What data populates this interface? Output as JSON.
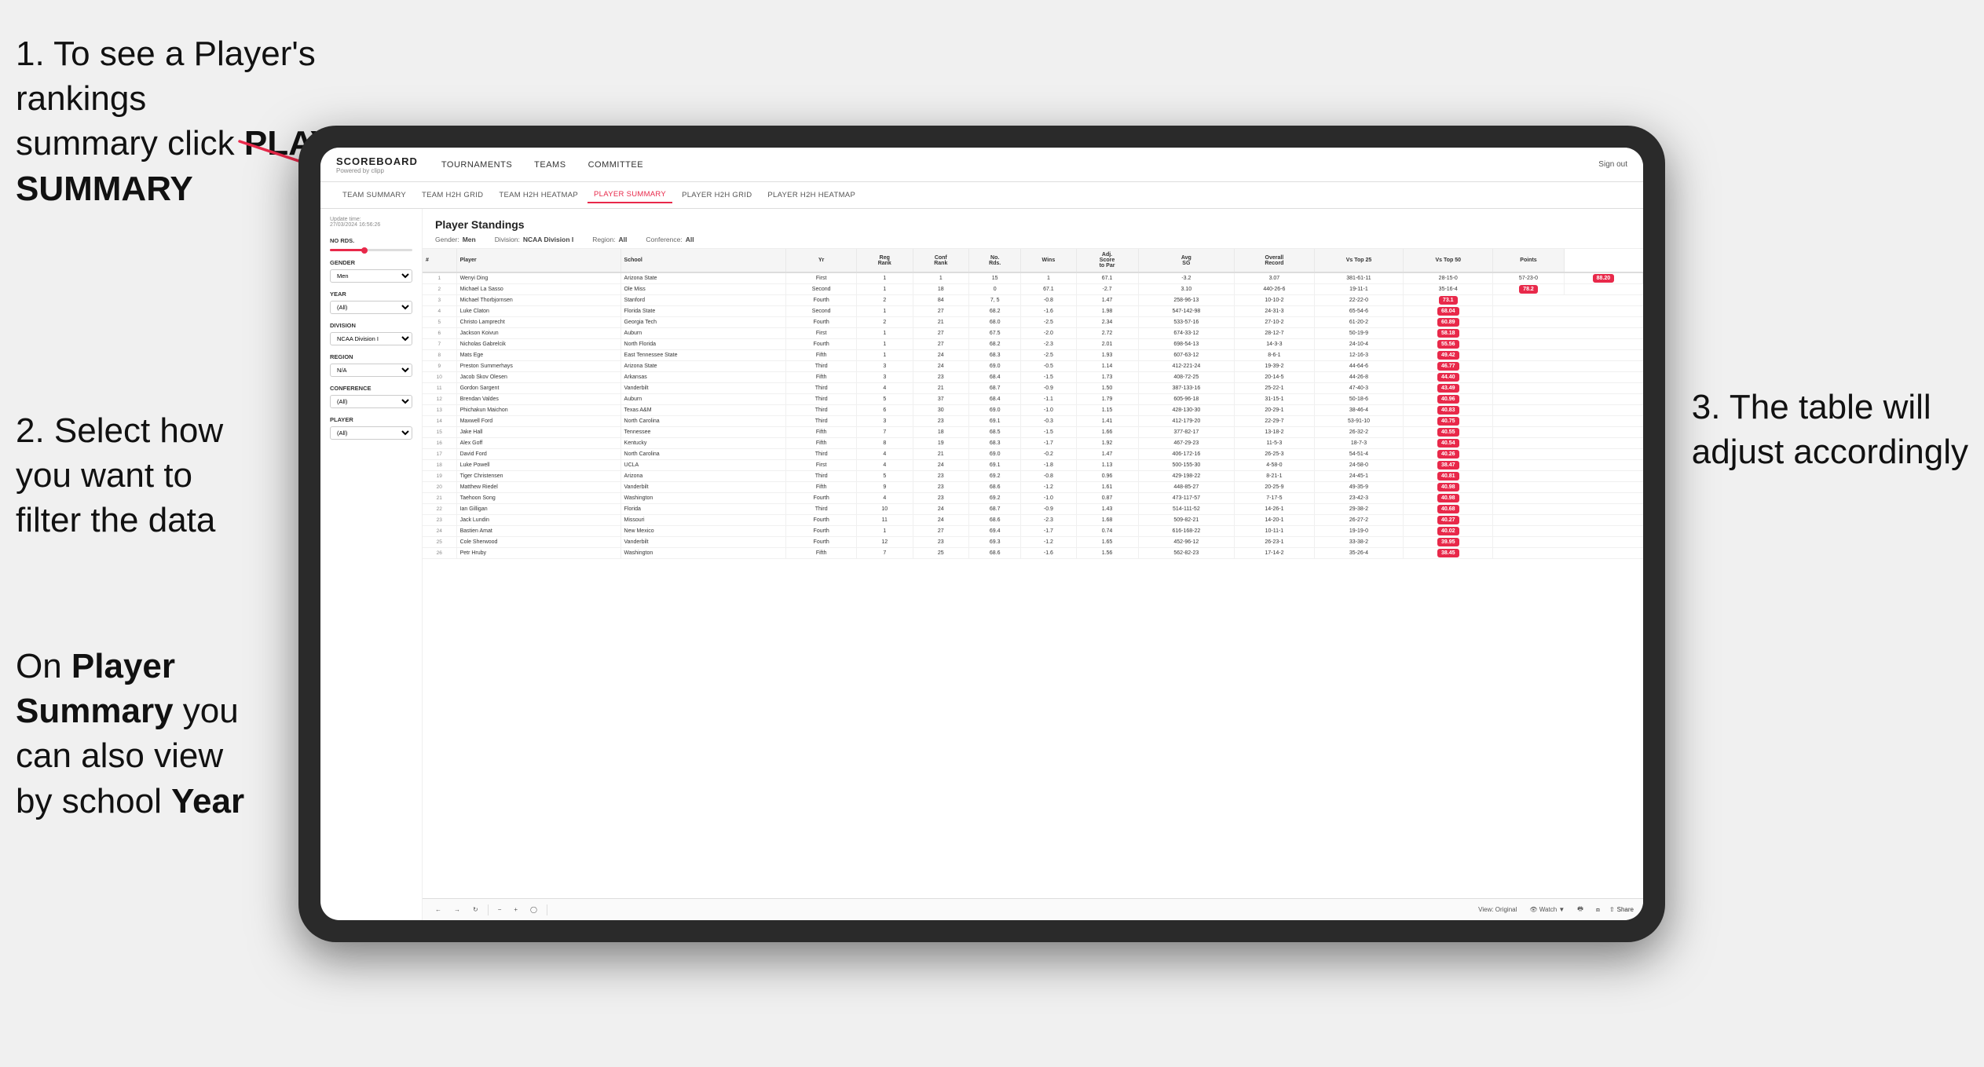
{
  "annotations": {
    "note1_line1": "1. To see a Player's rankings",
    "note1_line2": "summary click ",
    "note1_bold": "PLAYER SUMMARY",
    "note2_line1": "2. Select how",
    "note2_line2": "you want to",
    "note2_line3": "filter the data",
    "note2b_line1": "On ",
    "note2b_bold1": "Player",
    "note2b_line2": "Summary",
    "note2b_line3": " you",
    "note2b_line4": "can also view",
    "note2b_line5": "by school ",
    "note2b_bold2": "Year",
    "note3_line1": "3. The table will",
    "note3_line2": "adjust accordingly"
  },
  "nav": {
    "logo": "SCOREBOARD",
    "logo_sub": "Powered by clipp",
    "links": [
      "TOURNAMENTS",
      "TEAMS",
      "COMMITTEE"
    ],
    "sign_out": "Sign out"
  },
  "sub_nav": {
    "links": [
      "TEAM SUMMARY",
      "TEAM H2H GRID",
      "TEAM H2H HEATMAP",
      "PLAYER SUMMARY",
      "PLAYER H2H GRID",
      "PLAYER H2H HEATMAP"
    ],
    "active": "PLAYER SUMMARY"
  },
  "filters": {
    "update_time_label": "Update time:",
    "update_time_value": "27/03/2024 16:56:26",
    "no_rds_label": "No Rds.",
    "gender_label": "Gender",
    "gender_value": "Men",
    "year_label": "Year",
    "year_value": "(All)",
    "division_label": "Division",
    "division_value": "NCAA Division I",
    "region_label": "Region",
    "region_value": "N/A",
    "conference_label": "Conference",
    "conference_value": "(All)",
    "player_label": "Player",
    "player_value": "(All)"
  },
  "standings": {
    "title": "Player Standings",
    "gender_label": "Gender:",
    "gender_value": "Men",
    "division_label": "Division:",
    "division_value": "NCAA Division I",
    "region_label": "Region:",
    "region_value": "All",
    "conference_label": "Conference:",
    "conference_value": "All"
  },
  "table": {
    "headers": [
      "#",
      "Player",
      "School",
      "Yr",
      "Reg Rank",
      "Conf Rank",
      "No. Rds.",
      "Wins",
      "Adj. Score to Par",
      "Avg SG",
      "Overall Record",
      "Vs Top 25",
      "Vs Top 50",
      "Points"
    ],
    "rows": [
      [
        "1",
        "Wenyi Ding",
        "Arizona State",
        "First",
        "1",
        "1",
        "15",
        "1",
        "67.1",
        "-3.2",
        "3.07",
        "381-61-11",
        "28-15-0",
        "57-23-0",
        "88.20"
      ],
      [
        "2",
        "Michael La Sasso",
        "Ole Miss",
        "Second",
        "1",
        "18",
        "0",
        "67.1",
        "-2.7",
        "3.10",
        "440-26-6",
        "19-11-1",
        "35-16-4",
        "78.2"
      ],
      [
        "3",
        "Michael Thorbjornsen",
        "Stanford",
        "Fourth",
        "2",
        "84",
        "7, 5",
        "-0.8",
        "1.47",
        "258-96-13",
        "10-10-2",
        "22-22-0",
        "73.1"
      ],
      [
        "4",
        "Luke Claton",
        "Florida State",
        "Second",
        "1",
        "27",
        "68.2",
        "-1.6",
        "1.98",
        "547-142-98",
        "24-31-3",
        "65-54-6",
        "68.04"
      ],
      [
        "5",
        "Christo Lamprecht",
        "Georgia Tech",
        "Fourth",
        "2",
        "21",
        "68.0",
        "-2.5",
        "2.34",
        "533-57-16",
        "27-10-2",
        "61-20-2",
        "60.89"
      ],
      [
        "6",
        "Jackson Koivun",
        "Auburn",
        "First",
        "1",
        "27",
        "67.5",
        "-2.0",
        "2.72",
        "674-33-12",
        "28-12-7",
        "50-19-9",
        "58.18"
      ],
      [
        "7",
        "Nicholas Gabrelcik",
        "North Florida",
        "Fourth",
        "1",
        "27",
        "68.2",
        "-2.3",
        "2.01",
        "698-54-13",
        "14-3-3",
        "24-10-4",
        "55.56"
      ],
      [
        "8",
        "Mats Ege",
        "East Tennessee State",
        "Fifth",
        "1",
        "24",
        "68.3",
        "-2.5",
        "1.93",
        "607-63-12",
        "8-6-1",
        "12-16-3",
        "49.42"
      ],
      [
        "9",
        "Preston Summerhays",
        "Arizona State",
        "Third",
        "3",
        "24",
        "69.0",
        "-0.5",
        "1.14",
        "412-221-24",
        "19-39-2",
        "44-64-6",
        "46.77"
      ],
      [
        "10",
        "Jacob Skov Olesen",
        "Arkansas",
        "Fifth",
        "3",
        "23",
        "68.4",
        "-1.5",
        "1.73",
        "408-72-25",
        "20-14-5",
        "44-26-8",
        "44.40"
      ],
      [
        "11",
        "Gordon Sargent",
        "Vanderbilt",
        "Third",
        "4",
        "21",
        "68.7",
        "-0.9",
        "1.50",
        "387-133-16",
        "25-22-1",
        "47-40-3",
        "43.49"
      ],
      [
        "12",
        "Brendan Valdes",
        "Auburn",
        "Third",
        "5",
        "37",
        "68.4",
        "-1.1",
        "1.79",
        "605-96-18",
        "31-15-1",
        "50-18-6",
        "40.96"
      ],
      [
        "13",
        "Phichakun Maichon",
        "Texas A&M",
        "Third",
        "6",
        "30",
        "69.0",
        "-1.0",
        "1.15",
        "428-130-30",
        "20-29-1",
        "38-46-4",
        "40.83"
      ],
      [
        "14",
        "Maxwell Ford",
        "North Carolina",
        "Third",
        "3",
        "23",
        "69.1",
        "-0.3",
        "1.41",
        "412-179-20",
        "22-29-7",
        "53-91-10",
        "40.75"
      ],
      [
        "15",
        "Jake Hall",
        "Tennessee",
        "Fifth",
        "7",
        "18",
        "68.5",
        "-1.5",
        "1.66",
        "377-82-17",
        "13-18-2",
        "26-32-2",
        "40.55"
      ],
      [
        "16",
        "Alex Goff",
        "Kentucky",
        "Fifth",
        "8",
        "19",
        "68.3",
        "-1.7",
        "1.92",
        "467-29-23",
        "11-5-3",
        "18-7-3",
        "40.54"
      ],
      [
        "17",
        "David Ford",
        "North Carolina",
        "Third",
        "4",
        "21",
        "69.0",
        "-0.2",
        "1.47",
        "406-172-16",
        "26-25-3",
        "54-51-4",
        "40.26"
      ],
      [
        "18",
        "Luke Powell",
        "UCLA",
        "First",
        "4",
        "24",
        "69.1",
        "-1.8",
        "1.13",
        "500-155-30",
        "4-58-0",
        "24-58-0",
        "38.47"
      ],
      [
        "19",
        "Tiger Christensen",
        "Arizona",
        "Third",
        "5",
        "23",
        "69.2",
        "-0.8",
        "0.96",
        "429-198-22",
        "8-21-1",
        "24-45-1",
        "40.81"
      ],
      [
        "20",
        "Matthew Riedel",
        "Vanderbilt",
        "Fifth",
        "9",
        "23",
        "68.6",
        "-1.2",
        "1.61",
        "448-85-27",
        "20-25-9",
        "49-35-9",
        "40.98"
      ],
      [
        "21",
        "Taehoon Song",
        "Washington",
        "Fourth",
        "4",
        "23",
        "69.2",
        "-1.0",
        "0.87",
        "473-117-57",
        "7-17-5",
        "23-42-3",
        "40.98"
      ],
      [
        "22",
        "Ian Gilligan",
        "Florida",
        "Third",
        "10",
        "24",
        "68.7",
        "-0.9",
        "1.43",
        "514-111-52",
        "14-26-1",
        "29-38-2",
        "40.68"
      ],
      [
        "23",
        "Jack Lundin",
        "Missouri",
        "Fourth",
        "11",
        "24",
        "68.6",
        "-2.3",
        "1.68",
        "509-82-21",
        "14-20-1",
        "26-27-2",
        "40.27"
      ],
      [
        "24",
        "Bastien Amat",
        "New Mexico",
        "Fourth",
        "1",
        "27",
        "69.4",
        "-1.7",
        "0.74",
        "616-168-22",
        "10-11-1",
        "19-19-0",
        "40.02"
      ],
      [
        "25",
        "Cole Sherwood",
        "Vanderbilt",
        "Fourth",
        "12",
        "23",
        "69.3",
        "-1.2",
        "1.65",
        "452-96-12",
        "26-23-1",
        "33-38-2",
        "39.95"
      ],
      [
        "26",
        "Petr Hruby",
        "Washington",
        "Fifth",
        "7",
        "25",
        "68.6",
        "-1.6",
        "1.56",
        "562-82-23",
        "17-14-2",
        "35-26-4",
        "38.45"
      ]
    ]
  },
  "toolbar": {
    "view_label": "View: Original",
    "watch_label": "Watch",
    "share_label": "Share"
  }
}
